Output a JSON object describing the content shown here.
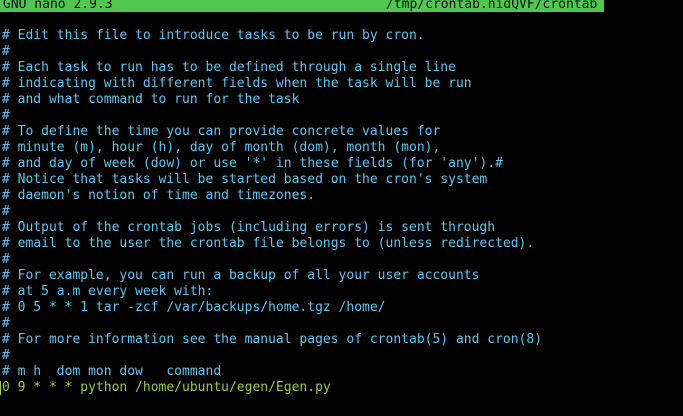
{
  "titlebar": {
    "app": "GNU nano 2.9.3",
    "filename": "/tmp/crontab.hidQVF/crontab"
  },
  "colors": {
    "titlebar_bg": "#4ec94e",
    "comment": "#5cc8ee",
    "code": "#9acd32",
    "background": "#000000"
  },
  "editor": {
    "lines": [
      "# Edit this file to introduce tasks to be run by cron.",
      "#",
      "# Each task to run has to be defined through a single line",
      "# indicating with different fields when the task will be run",
      "# and what command to run for the task",
      "#",
      "# To define the time you can provide concrete values for",
      "# minute (m), hour (h), day of month (dom), month (mon),",
      "# and day of week (dow) or use '*' in these fields (for 'any').#",
      "# Notice that tasks will be started based on the cron's system",
      "# daemon's notion of time and timezones.",
      "#",
      "# Output of the crontab jobs (including errors) is sent through",
      "# email to the user the crontab file belongs to (unless redirected).",
      "#",
      "# For example, you can run a backup of all your user accounts",
      "# at 5 a.m every week with:",
      "# 0 5 * * 1 tar -zcf /var/backups/home.tgz /home/",
      "#",
      "# For more information see the manual pages of crontab(5) and cron(8)",
      "#",
      "# m h  dom mon dow   command",
      "0 9 * * * python /home/ubuntu/egen/Egen.py"
    ]
  }
}
